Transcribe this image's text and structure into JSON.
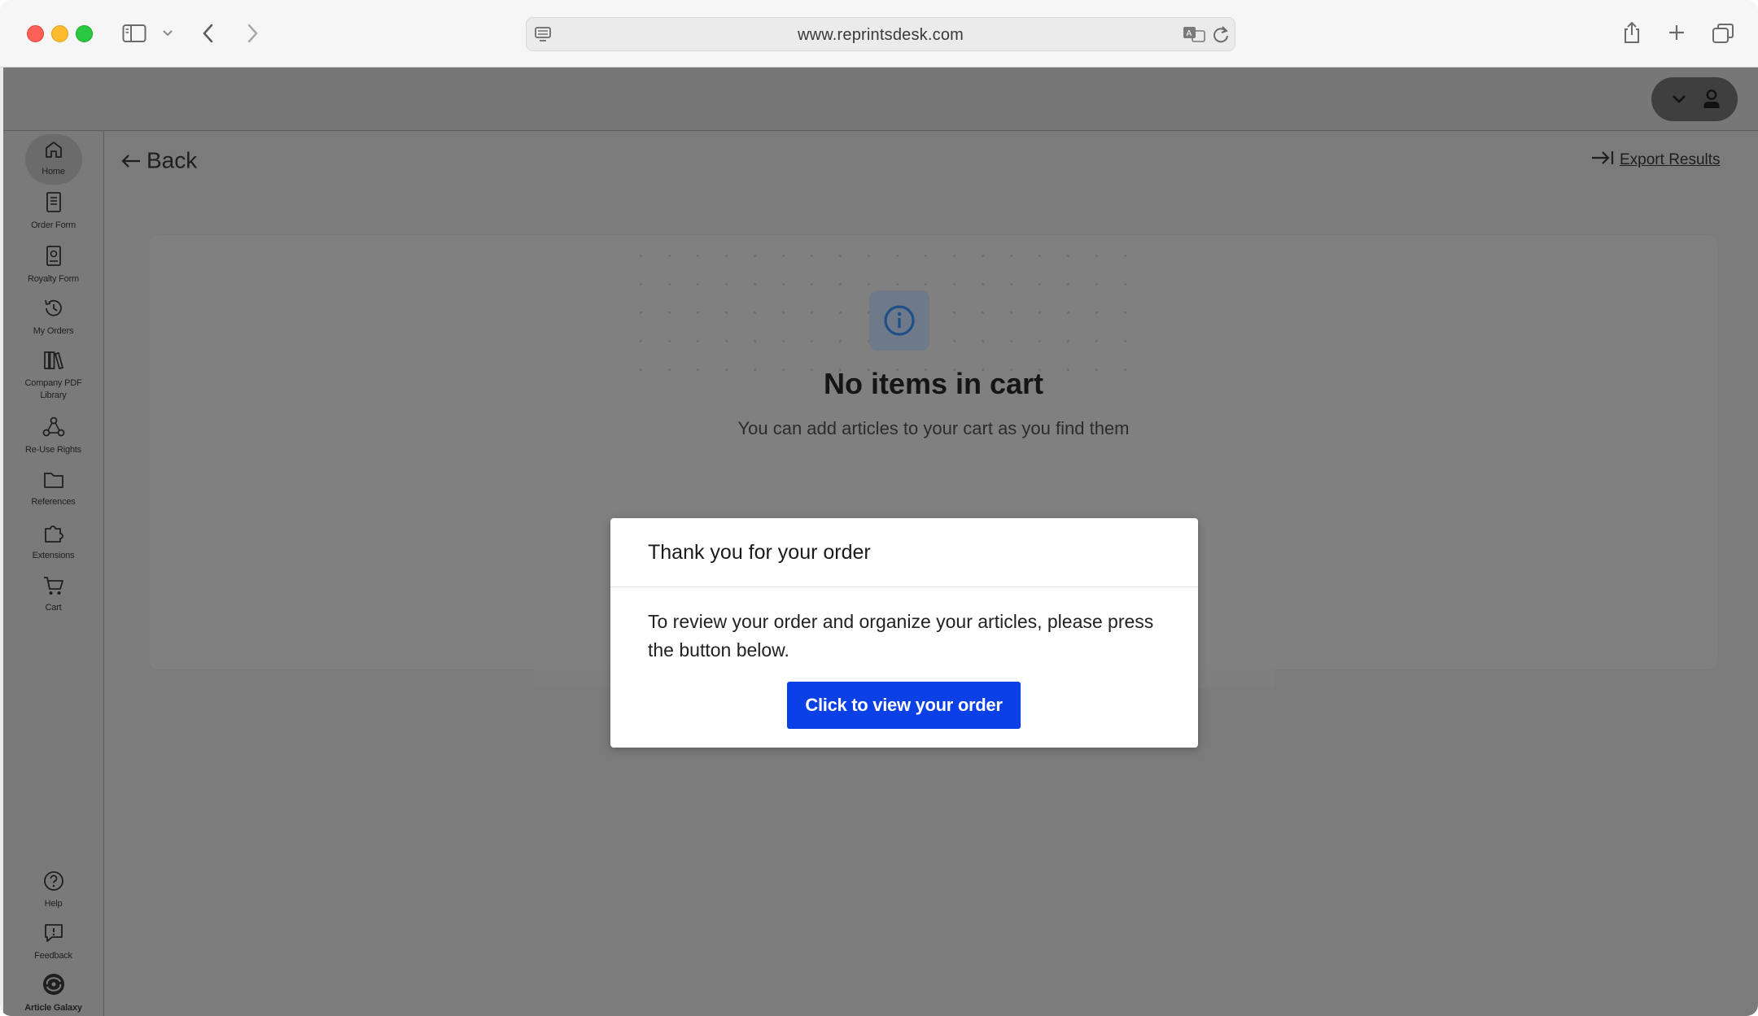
{
  "browser": {
    "url": "www.reprintsdesk.com"
  },
  "sidebar": {
    "items": [
      {
        "label": "Home",
        "icon": "home-icon"
      },
      {
        "label": "Order Form",
        "icon": "document-icon"
      },
      {
        "label": "Royalty Form",
        "icon": "royalty-icon"
      },
      {
        "label": "My Orders",
        "icon": "history-icon"
      },
      {
        "label": "Company PDF",
        "label2": "Library",
        "icon": "library-icon"
      },
      {
        "label": "Re-Use Rights",
        "icon": "share-icon"
      },
      {
        "label": "References",
        "icon": "folder-icon"
      },
      {
        "label": "Extensions",
        "icon": "puzzle-icon"
      },
      {
        "label": "Cart",
        "icon": "cart-icon"
      }
    ],
    "bottom": [
      {
        "label": "Help",
        "icon": "help-icon"
      },
      {
        "label": "Feedback",
        "icon": "feedback-icon"
      },
      {
        "label": "Article Galaxy",
        "icon": "article-galaxy-logo"
      }
    ]
  },
  "header": {
    "back_label": "Back",
    "export_label": "Export Results"
  },
  "empty_state": {
    "title": "No items in cart",
    "subtitle": "You can add articles to your cart as you find them"
  },
  "modal": {
    "title": "Thank you for your order",
    "body": "To review your order and organize your articles, please press the button below.",
    "button_label": "Click to view your order"
  },
  "colors": {
    "primary_button": "#0b40e6",
    "overlay": "#7b7b7b",
    "info_icon": "#1f4f86"
  }
}
